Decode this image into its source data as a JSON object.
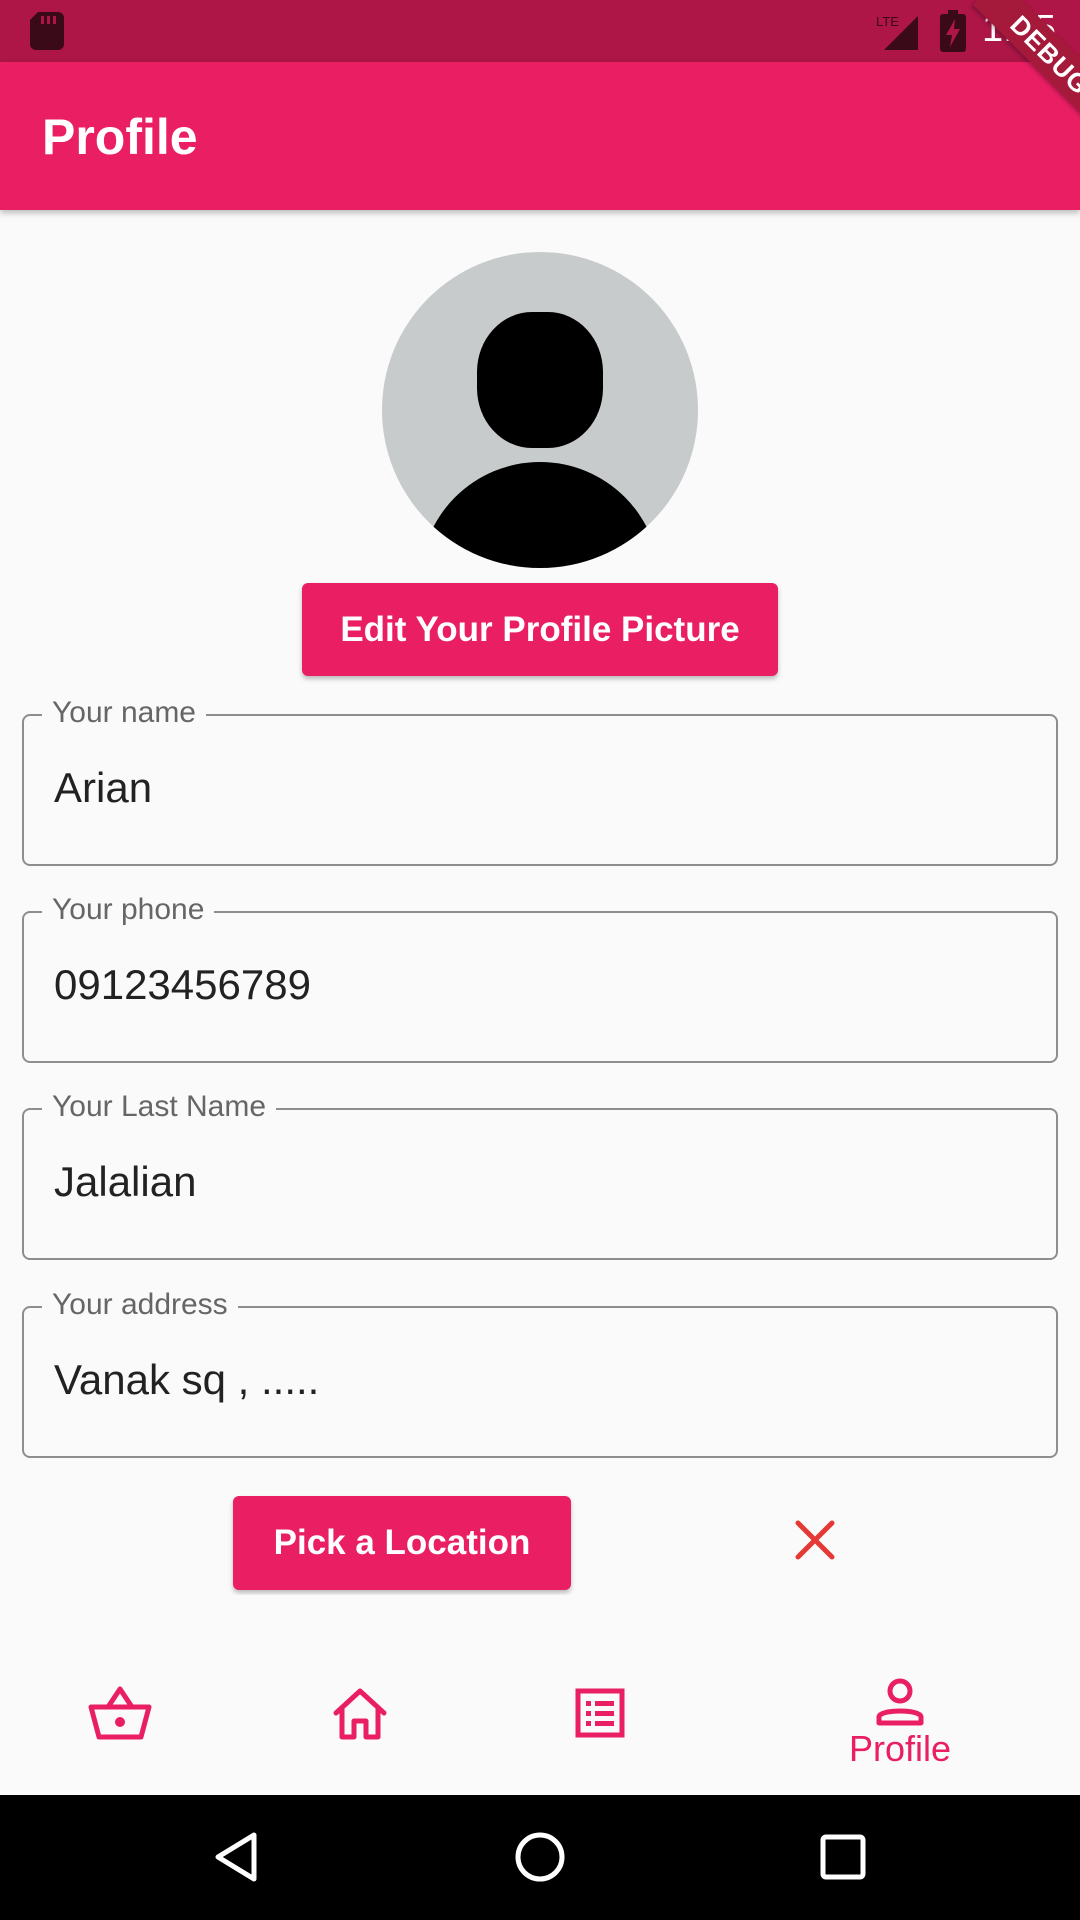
{
  "status_bar": {
    "time": "1:35",
    "network": "LTE",
    "icons": [
      "sd-card-icon",
      "lte-signal-icon",
      "battery-charging-icon"
    ]
  },
  "app_bar": {
    "title": "Profile",
    "debug_banner": "DEBUG"
  },
  "profile": {
    "avatar_icon": "default-avatar-icon",
    "edit_picture_label": "Edit Your Profile Picture"
  },
  "fields": {
    "name": {
      "label": "Your name",
      "value": "Arian"
    },
    "phone": {
      "label": "Your phone",
      "value": "09123456789"
    },
    "last_name": {
      "label": "Your Last Name",
      "value": "Jalalian"
    },
    "address": {
      "label": "Your address",
      "value": "Vanak sq , ....."
    }
  },
  "location": {
    "pick_label": "Pick a Location",
    "clear_icon": "close-icon"
  },
  "bottom_nav": {
    "items": [
      {
        "icon": "basket-icon",
        "label": ""
      },
      {
        "icon": "home-icon",
        "label": ""
      },
      {
        "icon": "list-icon",
        "label": ""
      },
      {
        "icon": "person-icon",
        "label": "Profile",
        "selected": true
      }
    ]
  },
  "colors": {
    "primary": "#e91e63",
    "status_bar": "#ad1647",
    "clear_icon": "#e53935"
  }
}
